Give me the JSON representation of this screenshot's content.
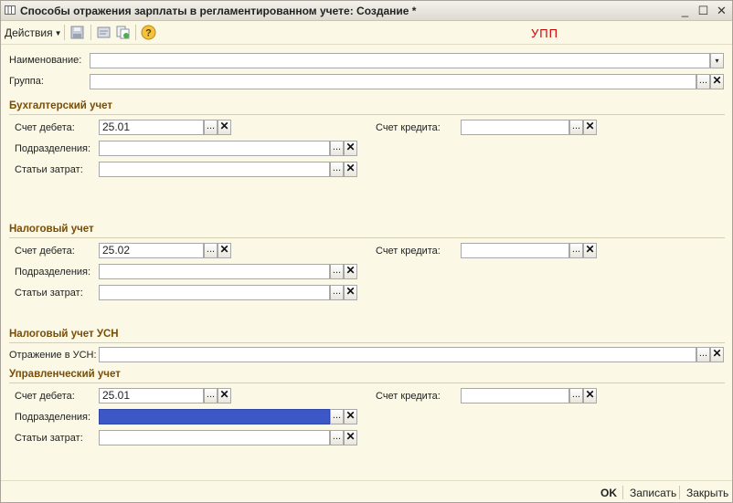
{
  "window": {
    "title": "Способы отражения зарплаты в регламентированном учете: Создание *"
  },
  "toolbar": {
    "actions_label": "Действия",
    "watermark": "УПП"
  },
  "general": {
    "name_label": "Наименование:",
    "name_value": "",
    "group_label": "Группа:",
    "group_value": ""
  },
  "accounting": {
    "title": "Бухгалтерский учет",
    "debit_label": "Счет дебета:",
    "debit_value": "25.01",
    "credit_label": "Счет кредита:",
    "credit_value": "",
    "divisions_label": "Подразделения:",
    "divisions_value": "",
    "costs_label": "Статьи затрат:",
    "costs_value": ""
  },
  "tax": {
    "title": "Налоговый учет",
    "debit_label": "Счет дебета:",
    "debit_value": "25.02",
    "credit_label": "Счет кредита:",
    "credit_value": "",
    "divisions_label": "Подразделения:",
    "divisions_value": "",
    "costs_label": "Статьи затрат:",
    "costs_value": ""
  },
  "usn": {
    "title": "Налоговый учет УСН",
    "reflection_label": "Отражение в УСН:",
    "reflection_value": ""
  },
  "management": {
    "title": "Управленческий учет",
    "debit_label": "Счет дебета:",
    "debit_value": "25.01",
    "credit_label": "Счет кредита:",
    "credit_value": "",
    "divisions_label": "Подразделения:",
    "divisions_value": "",
    "costs_label": "Статьи затрат:",
    "costs_value": ""
  },
  "common": {
    "select_button": "...",
    "clear_button": "✕",
    "dropdown_button": "▾"
  },
  "footer": {
    "ok": "OK",
    "save": "Записать",
    "close": "Закрыть"
  },
  "titlebar_buttons": {
    "minimize": "_",
    "maximize": "☐",
    "close": "✕"
  }
}
